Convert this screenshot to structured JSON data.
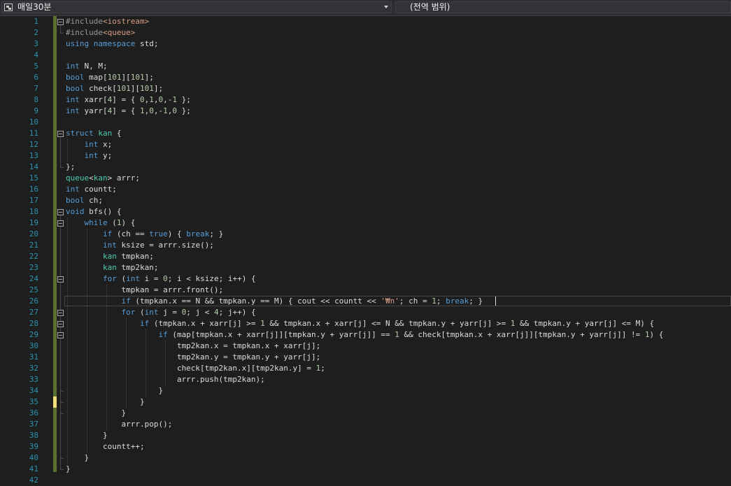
{
  "navbar": {
    "project_label": "매일30분",
    "scope_label": "(전역 범위)",
    "project_icon": "project-icon"
  },
  "editor": {
    "current_line": 26,
    "lines": [
      {
        "n": "1",
        "code": [
          {
            "t": "#include",
            "c": "pp"
          },
          {
            "t": "<iostream>",
            "c": "str"
          }
        ]
      },
      {
        "n": "2",
        "code": [
          {
            "t": "#include",
            "c": "pp"
          },
          {
            "t": "<queue>",
            "c": "str"
          }
        ]
      },
      {
        "n": "3",
        "code": [
          {
            "t": "using",
            "c": "kw"
          },
          {
            "t": " "
          },
          {
            "t": "namespace",
            "c": "kw"
          },
          {
            "t": " std;"
          }
        ]
      },
      {
        "n": "4",
        "code": []
      },
      {
        "n": "5",
        "code": [
          {
            "t": "int",
            "c": "kw"
          },
          {
            "t": " N, M;"
          }
        ]
      },
      {
        "n": "6",
        "code": [
          {
            "t": "bool",
            "c": "kw"
          },
          {
            "t": " map["
          },
          {
            "t": "101",
            "c": "num"
          },
          {
            "t": "]["
          },
          {
            "t": "101",
            "c": "num"
          },
          {
            "t": "];"
          }
        ]
      },
      {
        "n": "7",
        "code": [
          {
            "t": "bool",
            "c": "kw"
          },
          {
            "t": " check["
          },
          {
            "t": "101",
            "c": "num"
          },
          {
            "t": "]["
          },
          {
            "t": "101",
            "c": "num"
          },
          {
            "t": "];"
          }
        ]
      },
      {
        "n": "8",
        "code": [
          {
            "t": "int",
            "c": "kw"
          },
          {
            "t": " xarr["
          },
          {
            "t": "4",
            "c": "num"
          },
          {
            "t": "] = { "
          },
          {
            "t": "0",
            "c": "num"
          },
          {
            "t": ","
          },
          {
            "t": "1",
            "c": "num"
          },
          {
            "t": ","
          },
          {
            "t": "0",
            "c": "num"
          },
          {
            "t": ",-"
          },
          {
            "t": "1",
            "c": "num"
          },
          {
            "t": " };"
          }
        ]
      },
      {
        "n": "9",
        "code": [
          {
            "t": "int",
            "c": "kw"
          },
          {
            "t": " yarr["
          },
          {
            "t": "4",
            "c": "num"
          },
          {
            "t": "] = { "
          },
          {
            "t": "1",
            "c": "num"
          },
          {
            "t": ","
          },
          {
            "t": "0",
            "c": "num"
          },
          {
            "t": ",-"
          },
          {
            "t": "1",
            "c": "num"
          },
          {
            "t": ","
          },
          {
            "t": "0",
            "c": "num"
          },
          {
            "t": " };"
          }
        ]
      },
      {
        "n": "10",
        "code": []
      },
      {
        "n": "11",
        "code": [
          {
            "t": "struct",
            "c": "kw"
          },
          {
            "t": " "
          },
          {
            "t": "kan",
            "c": "tp"
          },
          {
            "t": " {"
          }
        ]
      },
      {
        "n": "12",
        "code": [
          {
            "t": "    "
          },
          {
            "t": "int",
            "c": "kw"
          },
          {
            "t": " x;"
          }
        ]
      },
      {
        "n": "13",
        "code": [
          {
            "t": "    "
          },
          {
            "t": "int",
            "c": "kw"
          },
          {
            "t": " y;"
          }
        ]
      },
      {
        "n": "14",
        "code": [
          {
            "t": "};"
          }
        ]
      },
      {
        "n": "15",
        "code": [
          {
            "t": "queue",
            "c": "tp"
          },
          {
            "t": "<"
          },
          {
            "t": "kan",
            "c": "tp"
          },
          {
            "t": "> arrr;"
          }
        ]
      },
      {
        "n": "16",
        "code": [
          {
            "t": "int",
            "c": "kw"
          },
          {
            "t": " countt;"
          }
        ]
      },
      {
        "n": "17",
        "code": [
          {
            "t": "bool",
            "c": "kw"
          },
          {
            "t": " ch;"
          }
        ]
      },
      {
        "n": "18",
        "code": [
          {
            "t": "void",
            "c": "kw"
          },
          {
            "t": " bfs() {"
          }
        ]
      },
      {
        "n": "19",
        "code": [
          {
            "t": "    "
          },
          {
            "t": "while",
            "c": "kw"
          },
          {
            "t": " ("
          },
          {
            "t": "1",
            "c": "num"
          },
          {
            "t": ") {"
          }
        ]
      },
      {
        "n": "20",
        "code": [
          {
            "t": "        "
          },
          {
            "t": "if",
            "c": "kw"
          },
          {
            "t": " (ch == "
          },
          {
            "t": "true",
            "c": "kw"
          },
          {
            "t": ") { "
          },
          {
            "t": "break",
            "c": "kw"
          },
          {
            "t": "; }"
          }
        ]
      },
      {
        "n": "21",
        "code": [
          {
            "t": "        "
          },
          {
            "t": "int",
            "c": "kw"
          },
          {
            "t": " ksize = arrr.size();"
          }
        ]
      },
      {
        "n": "22",
        "code": [
          {
            "t": "        "
          },
          {
            "t": "kan",
            "c": "tp"
          },
          {
            "t": " tmpkan;"
          }
        ]
      },
      {
        "n": "23",
        "code": [
          {
            "t": "        "
          },
          {
            "t": "kan",
            "c": "tp"
          },
          {
            "t": " tmp2kan;"
          }
        ]
      },
      {
        "n": "24",
        "code": [
          {
            "t": "        "
          },
          {
            "t": "for",
            "c": "kw"
          },
          {
            "t": " ("
          },
          {
            "t": "int",
            "c": "kw"
          },
          {
            "t": " i = "
          },
          {
            "t": "0",
            "c": "num"
          },
          {
            "t": "; i < ksize; i++) {"
          }
        ]
      },
      {
        "n": "25",
        "code": [
          {
            "t": "            tmpkan = arrr.front();"
          }
        ]
      },
      {
        "n": "26",
        "code": [
          {
            "t": "            "
          },
          {
            "t": "if",
            "c": "kw"
          },
          {
            "t": " (tmpkan.x == N && tmpkan.y == M) { cout << countt << "
          },
          {
            "t": "'₩n'",
            "c": "str"
          },
          {
            "t": "; ch = "
          },
          {
            "t": "1",
            "c": "num"
          },
          {
            "t": "; "
          },
          {
            "t": "break",
            "c": "kw"
          },
          {
            "t": "; }"
          }
        ]
      },
      {
        "n": "27",
        "code": [
          {
            "t": "            "
          },
          {
            "t": "for",
            "c": "kw"
          },
          {
            "t": " ("
          },
          {
            "t": "int",
            "c": "kw"
          },
          {
            "t": " j = "
          },
          {
            "t": "0",
            "c": "num"
          },
          {
            "t": "; j < "
          },
          {
            "t": "4",
            "c": "num"
          },
          {
            "t": "; j++) {"
          }
        ]
      },
      {
        "n": "28",
        "code": [
          {
            "t": "                "
          },
          {
            "t": "if",
            "c": "kw"
          },
          {
            "t": " (tmpkan.x + xarr[j] >= "
          },
          {
            "t": "1",
            "c": "num"
          },
          {
            "t": " && tmpkan.x + xarr[j] <= N && tmpkan.y + yarr[j] >= "
          },
          {
            "t": "1",
            "c": "num"
          },
          {
            "t": " && tmpkan.y + yarr[j] <= M) {"
          }
        ]
      },
      {
        "n": "29",
        "code": [
          {
            "t": "                    "
          },
          {
            "t": "if",
            "c": "kw"
          },
          {
            "t": " (map[tmpkan.x + xarr[j]][tmpkan.y + yarr[j]] == "
          },
          {
            "t": "1",
            "c": "num"
          },
          {
            "t": " && check[tmpkan.x + xarr[j]][tmpkan.y + yarr[j]] != "
          },
          {
            "t": "1",
            "c": "num"
          },
          {
            "t": ") {"
          }
        ]
      },
      {
        "n": "30",
        "code": [
          {
            "t": "                        tmp2kan.x = tmpkan.x + xarr[j];"
          }
        ]
      },
      {
        "n": "31",
        "code": [
          {
            "t": "                        tmp2kan.y = tmpkan.y + yarr[j];"
          }
        ]
      },
      {
        "n": "32",
        "code": [
          {
            "t": "                        check[tmp2kan.x][tmp2kan.y] = "
          },
          {
            "t": "1",
            "c": "num"
          },
          {
            "t": ";"
          }
        ]
      },
      {
        "n": "33",
        "code": [
          {
            "t": "                        arrr.push(tmp2kan);"
          }
        ]
      },
      {
        "n": "34",
        "code": [
          {
            "t": "                    }"
          }
        ]
      },
      {
        "n": "35",
        "code": [
          {
            "t": "                }"
          }
        ]
      },
      {
        "n": "36",
        "code": [
          {
            "t": "            }"
          }
        ]
      },
      {
        "n": "37",
        "code": [
          {
            "t": "            arrr.pop();"
          }
        ]
      },
      {
        "n": "38",
        "code": [
          {
            "t": "        }"
          }
        ]
      },
      {
        "n": "39",
        "code": [
          {
            "t": "        countt++;"
          }
        ]
      },
      {
        "n": "40",
        "code": [
          {
            "t": "    }"
          }
        ]
      },
      {
        "n": "41",
        "code": [
          {
            "t": "}"
          }
        ]
      },
      {
        "n": "42",
        "code": []
      }
    ]
  }
}
